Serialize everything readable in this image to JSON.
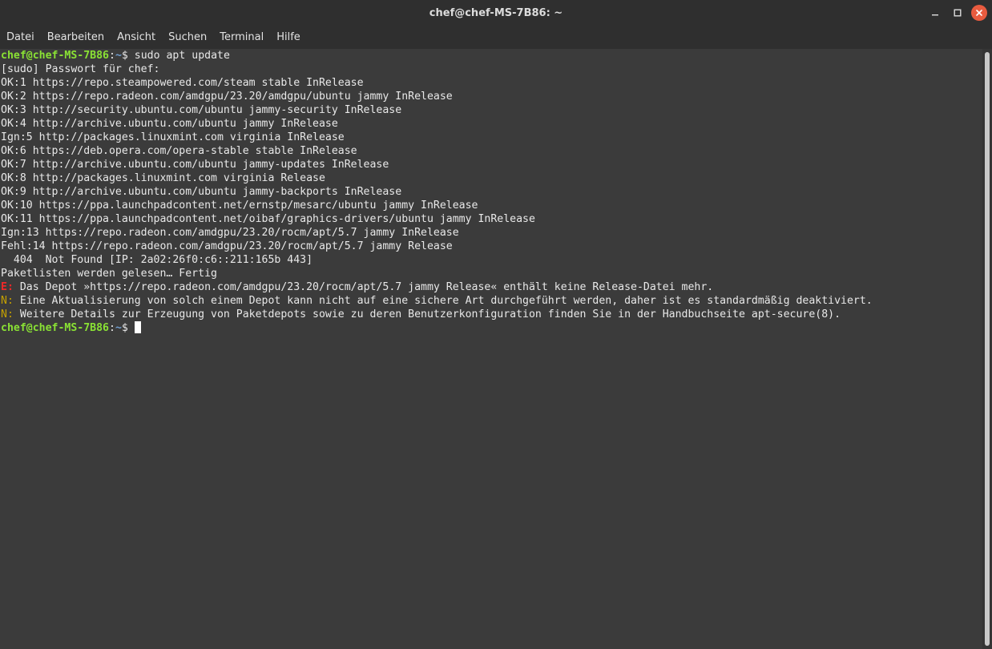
{
  "window": {
    "title": "chef@chef-MS-7B86: ~"
  },
  "menu": {
    "items": [
      "Datei",
      "Bearbeiten",
      "Ansicht",
      "Suchen",
      "Terminal",
      "Hilfe"
    ]
  },
  "terminal": {
    "prompt_user": "chef@chef-MS-7B86",
    "prompt_path": "~",
    "prompt_symbol": "$",
    "command": "sudo apt update",
    "lines": [
      "[sudo] Passwort für chef:",
      "OK:1 https://repo.steampowered.com/steam stable InRelease",
      "OK:2 https://repo.radeon.com/amdgpu/23.20/amdgpu/ubuntu jammy InRelease",
      "OK:3 http://security.ubuntu.com/ubuntu jammy-security InRelease",
      "OK:4 http://archive.ubuntu.com/ubuntu jammy InRelease",
      "Ign:5 http://packages.linuxmint.com virginia InRelease",
      "OK:6 https://deb.opera.com/opera-stable stable InRelease",
      "OK:7 http://archive.ubuntu.com/ubuntu jammy-updates InRelease",
      "OK:8 http://packages.linuxmint.com virginia Release",
      "OK:9 http://archive.ubuntu.com/ubuntu jammy-backports InRelease",
      "OK:10 https://ppa.launchpadcontent.net/ernstp/mesarc/ubuntu jammy InRelease",
      "OK:11 https://ppa.launchpadcontent.net/oibaf/graphics-drivers/ubuntu jammy InRelease",
      "Ign:13 https://repo.radeon.com/amdgpu/23.20/rocm/apt/5.7 jammy InRelease",
      "Fehl:14 https://repo.radeon.com/amdgpu/23.20/rocm/apt/5.7 jammy Release",
      "  404  Not Found [IP: 2a02:26f0:c6::211:165b 443]",
      "Paketlisten werden gelesen… Fertig"
    ],
    "messages": [
      {
        "tag": "E:",
        "text": " Das Depot »https://repo.radeon.com/amdgpu/23.20/rocm/apt/5.7 jammy Release« enthält keine Release-Datei mehr."
      },
      {
        "tag": "N:",
        "text": " Eine Aktualisierung von solch einem Depot kann nicht auf eine sichere Art durchgeführt werden, daher ist es standardmäßig deaktiviert."
      },
      {
        "tag": "N:",
        "text": " Weitere Details zur Erzeugung von Paketdepots sowie zu deren Benutzerkonfiguration finden Sie in der Handbuchseite apt-secure(8)."
      }
    ]
  },
  "colors": {
    "prompt_user": "#8ae234",
    "prompt_path": "#729fcf",
    "error_tag": "#ef2929",
    "notice_tag": "#c4a000",
    "close_button": "#e95b3f"
  }
}
